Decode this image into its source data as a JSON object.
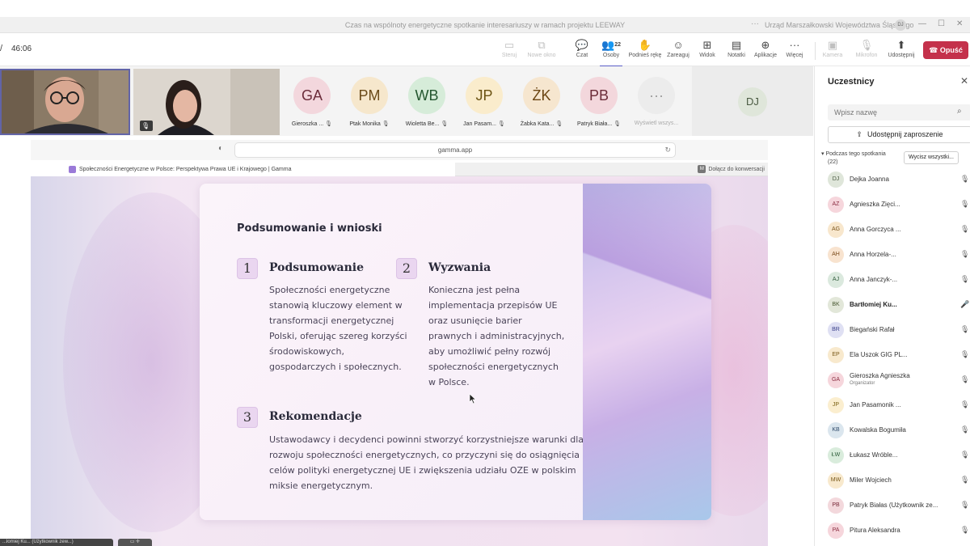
{
  "window": {
    "title": "Czas na wspólnoty energetyczne spotkanie interesariuszy w ramach projektu LEEWAY",
    "more_glyph": "···",
    "org": "Urząd Marszałkowski Województwa Śląskiego",
    "user_initials": "DJ",
    "win_minimize": "—",
    "win_maximize": "☐",
    "win_close": "✕"
  },
  "toolbar": {
    "left_glyph": "/",
    "timer": "46:06",
    "buttons": [
      {
        "label": "Steruj",
        "icon": "▭",
        "enabled": false
      },
      {
        "label": "Nowe okno",
        "icon": "⧉",
        "enabled": false
      },
      {
        "label": "Czat",
        "icon": "💬",
        "enabled": true
      },
      {
        "label": "Osoby",
        "icon": "👥",
        "enabled": true,
        "count": "22",
        "active": true
      },
      {
        "label": "Podnieś rękę",
        "icon": "✋",
        "enabled": true
      },
      {
        "label": "Zareaguj",
        "icon": "☺",
        "enabled": true
      },
      {
        "label": "Widok",
        "icon": "⊞",
        "enabled": true
      },
      {
        "label": "Notatki",
        "icon": "▤",
        "enabled": true
      },
      {
        "label": "Aplikacje",
        "icon": "⊕",
        "enabled": true
      },
      {
        "label": "Więcej",
        "icon": "···",
        "enabled": true
      },
      {
        "label": "Kamera",
        "icon": "▣",
        "enabled": false
      },
      {
        "label": "Mikrofon",
        "icon": "🎙",
        "enabled": false
      },
      {
        "label": "Udostępnij",
        "icon": "⬆",
        "enabled": true
      }
    ],
    "leave_label": "Opuść",
    "leave_icon": "☎"
  },
  "video_strip": {
    "muted_icon": "🎙",
    "participants": [
      {
        "initials": "GA",
        "name": "Gieroszka ...",
        "bg": "#f3d7dd",
        "fg": "#6b2c3a"
      },
      {
        "initials": "PM",
        "name": "Ptak Monika",
        "bg": "#f6e7cc",
        "fg": "#6b4b1a"
      },
      {
        "initials": "WB",
        "name": "Wioletta Be...",
        "bg": "#d6ecd9",
        "fg": "#24572f"
      },
      {
        "initials": "JP",
        "name": "Jan Pasam...",
        "bg": "#faeccc",
        "fg": "#6b5312"
      },
      {
        "initials": "ŻK",
        "name": "Żabka Kata...",
        "bg": "#f6e6cf",
        "fg": "#6b4512"
      },
      {
        "initials": "PB",
        "name": "Patryk Biała...",
        "bg": "#f3d7dc",
        "fg": "#6b2c38"
      },
      {
        "initials": "···",
        "name": "Wyświetl wszys...",
        "bg": "#ececec",
        "fg": "#999999"
      }
    ],
    "self_initials": "DJ"
  },
  "browser": {
    "url": "gamma.app",
    "shield_icon": "◐",
    "reload_icon": "↻",
    "tab_title": "Społeczności Energetyczne w Polsce: Perspektywa Prawa UE i Krajowego | Gamma",
    "join_badge": "M",
    "join_label": "Dołącz do konwersacji"
  },
  "slide": {
    "heading": "Podsumowanie i wnioski",
    "sections": [
      {
        "number": "1",
        "title": "Podsumowanie",
        "body": [
          "Społeczności energetyczne",
          "stanowią kluczowy element w",
          "transformacji energetycznej",
          "Polski, oferując szereg korzyści",
          "środowiskowych,",
          "gospodarczych i społecznych."
        ]
      },
      {
        "number": "2",
        "title": "Wyzwania",
        "body": [
          "Konieczna jest pełna",
          "implementacja przepisów UE",
          "oraz usunięcie barier",
          "prawnych i administracyjnych,",
          "aby umożliwić pełny rozwój",
          "społeczności energetycznych",
          "w Polsce."
        ]
      },
      {
        "number": "3",
        "title": "Rekomendacje",
        "body": [
          "Ustawodawcy i decydenci powinni stworzyć korzystniejsze warunki dla",
          "rozwoju społeczności energetycznych, co przyczyni się do osiągnięcia",
          "celów polityki energetycznej UE i zwiększenia udziału OZE w polskim",
          "miksie energetycznym."
        ]
      }
    ]
  },
  "bottom": {
    "label": "...łomiej Ku... (Użytkownik zew...)",
    "button": "▭  ✛"
  },
  "panel": {
    "title": "Uczestnicy",
    "close_icon": "✕",
    "search_placeholder": "Wpisz nazwę",
    "search_icon": "⌕",
    "invite_icon": "⇪",
    "invite_label": "Udostępnij zaproszenie",
    "section_line1": "Podczas tego spotkania",
    "section_line2": "(22)",
    "mute_all_label": "Wycisz wszystki...",
    "people": [
      {
        "initials": "DJ",
        "name": "Dejka Joanna",
        "bg": "#dfe6da",
        "fg": "#4a5a42",
        "mic": "🎙"
      },
      {
        "initials": "AZ",
        "name": "Agnieszka Zięci...",
        "bg": "#f6d6dc",
        "fg": "#8a2c40",
        "mic": "🎙"
      },
      {
        "initials": "AG",
        "name": "Anna Gorczyca ...",
        "bg": "#f8e7cd",
        "fg": "#7a531a",
        "mic": "🎙"
      },
      {
        "initials": "AH",
        "name": "Anna Horzela-...",
        "bg": "#f8e3cf",
        "fg": "#7a4a1a",
        "mic": "🎙"
      },
      {
        "initials": "AJ",
        "name": "Anna Janczyk-...",
        "bg": "#dbe9de",
        "fg": "#2f5a3a",
        "mic": "🎙"
      },
      {
        "initials": "BK",
        "name": "Bartłomiej Ku...",
        "bg": "#e2e7d9",
        "fg": "#4a5a32",
        "mic": "🎤",
        "bold": true
      },
      {
        "initials": "BR",
        "name": "Biegański Rafał",
        "bg": "#dfe0f3",
        "fg": "#3a3f8a",
        "mic": "🎙"
      },
      {
        "initials": "EP",
        "name": "Ela Uszok GIG PL...",
        "bg": "#f8e9cd",
        "fg": "#7a5a1a",
        "mic": "🎙"
      },
      {
        "initials": "GA",
        "name": "Gieroszka Agnieszka",
        "sub": "Organizator",
        "bg": "#f6d6dc",
        "fg": "#8a2c40",
        "mic": "🎙"
      },
      {
        "initials": "JP",
        "name": "Jan Pasamonik ...",
        "bg": "#fbeecf",
        "fg": "#7a6012",
        "mic": "🎙"
      },
      {
        "initials": "KB",
        "name": "Kowalska Bogumiła",
        "bg": "#dbe6ee",
        "fg": "#2f4a6a",
        "mic": "🎙"
      },
      {
        "initials": "ŁW",
        "name": "Łukasz Wróble...",
        "bg": "#d9ecdc",
        "fg": "#2a5a36",
        "mic": "🎙"
      },
      {
        "initials": "MW",
        "name": "Miler Wojciech",
        "bg": "#f8e9cd",
        "fg": "#7a5a1a",
        "mic": "🎙"
      },
      {
        "initials": "PB",
        "name": "Patryk Białas (Użytkownik ze...",
        "bg": "#f3d8dc",
        "fg": "#7a2c3a",
        "mic": "🎙"
      },
      {
        "initials": "PA",
        "name": "Pitura Aleksandra",
        "bg": "#f6d6dc",
        "fg": "#8a2c40",
        "mic": "🎙"
      }
    ]
  }
}
